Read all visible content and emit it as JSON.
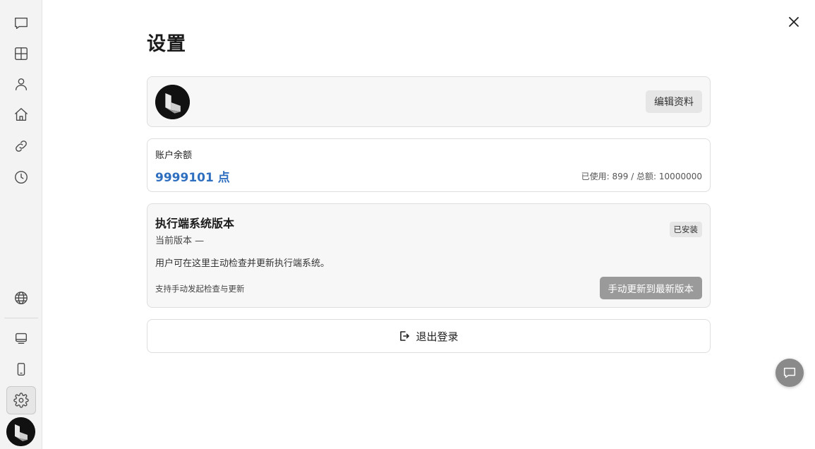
{
  "sidebar": {
    "items": [
      {
        "icon": "message-square-icon"
      },
      {
        "icon": "grid-icon"
      },
      {
        "icon": "user-icon"
      },
      {
        "icon": "home-icon"
      },
      {
        "icon": "link-icon"
      },
      {
        "icon": "clock-icon"
      },
      {
        "icon": "globe-icon"
      },
      {
        "icon": "monitor-icon"
      },
      {
        "icon": "smartphone-icon"
      },
      {
        "icon": "settings-icon",
        "active": true
      }
    ]
  },
  "page": {
    "title": "设置"
  },
  "profile": {
    "edit_label": "编辑资料"
  },
  "balance": {
    "label": "账户余额",
    "value": "9999101 点",
    "usage": "已使用: 899 / 总额: 10000000"
  },
  "version": {
    "title": "执行端系统版本",
    "current": "当前版本 —",
    "badge": "已安装",
    "description": "用户可在这里主动检查并更新执行端系统。",
    "hint": "支持手动发起检查与更新",
    "update_label": "手动更新到最新版本"
  },
  "logout": {
    "label": "退出登录"
  },
  "colors": {
    "accent": "#2f6fbf",
    "update_button": "#9a9a9a",
    "chat_fab": "#8a8a8a"
  }
}
